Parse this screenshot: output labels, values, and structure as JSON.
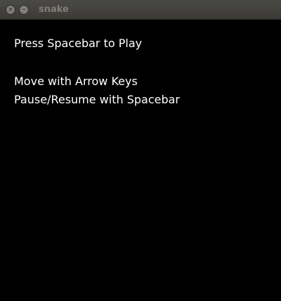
{
  "window": {
    "title": "snake",
    "close_glyph": "×",
    "minimize_glyph": "–",
    "close_icon": "close-icon",
    "minimize_icon": "minimize-icon"
  },
  "colors": {
    "background": "#000000",
    "text": "#ffffff",
    "titlebar": "#3c3b37"
  },
  "game": {
    "start_prompt": "Press Spacebar to Play",
    "instructions": [
      "Move with Arrow Keys",
      "Pause/Resume with Spacebar"
    ]
  }
}
